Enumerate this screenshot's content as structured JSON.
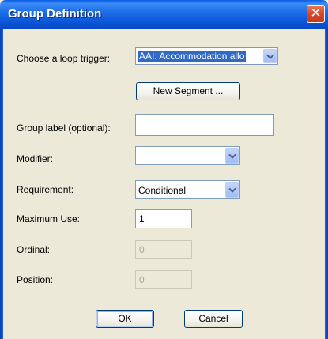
{
  "window": {
    "title": "Group Definition",
    "close_glyph": "✕"
  },
  "form": {
    "loop_trigger": {
      "label": "Choose a loop trigger:",
      "value": "AAI: Accommodation allo"
    },
    "new_segment_button": "New Segment ...",
    "group_label": {
      "label": "Group label (optional):",
      "value": ""
    },
    "modifier": {
      "label": "Modifier:",
      "value": ""
    },
    "requirement": {
      "label": "Requirement:",
      "value": "Conditional"
    },
    "maximum_use": {
      "label": "Maximum Use:",
      "value": "1"
    },
    "ordinal": {
      "label": "Ordinal:",
      "value": "0"
    },
    "position": {
      "label": "Position:",
      "value": "0"
    }
  },
  "buttons": {
    "ok": "OK",
    "cancel": "Cancel"
  },
  "colors": {
    "title_bar": "#0a55d8",
    "dialog_background": "#ece9d8",
    "field_border": "#7f9db9",
    "selection_highlight": "#316ac5",
    "close_button": "#d9472a"
  }
}
